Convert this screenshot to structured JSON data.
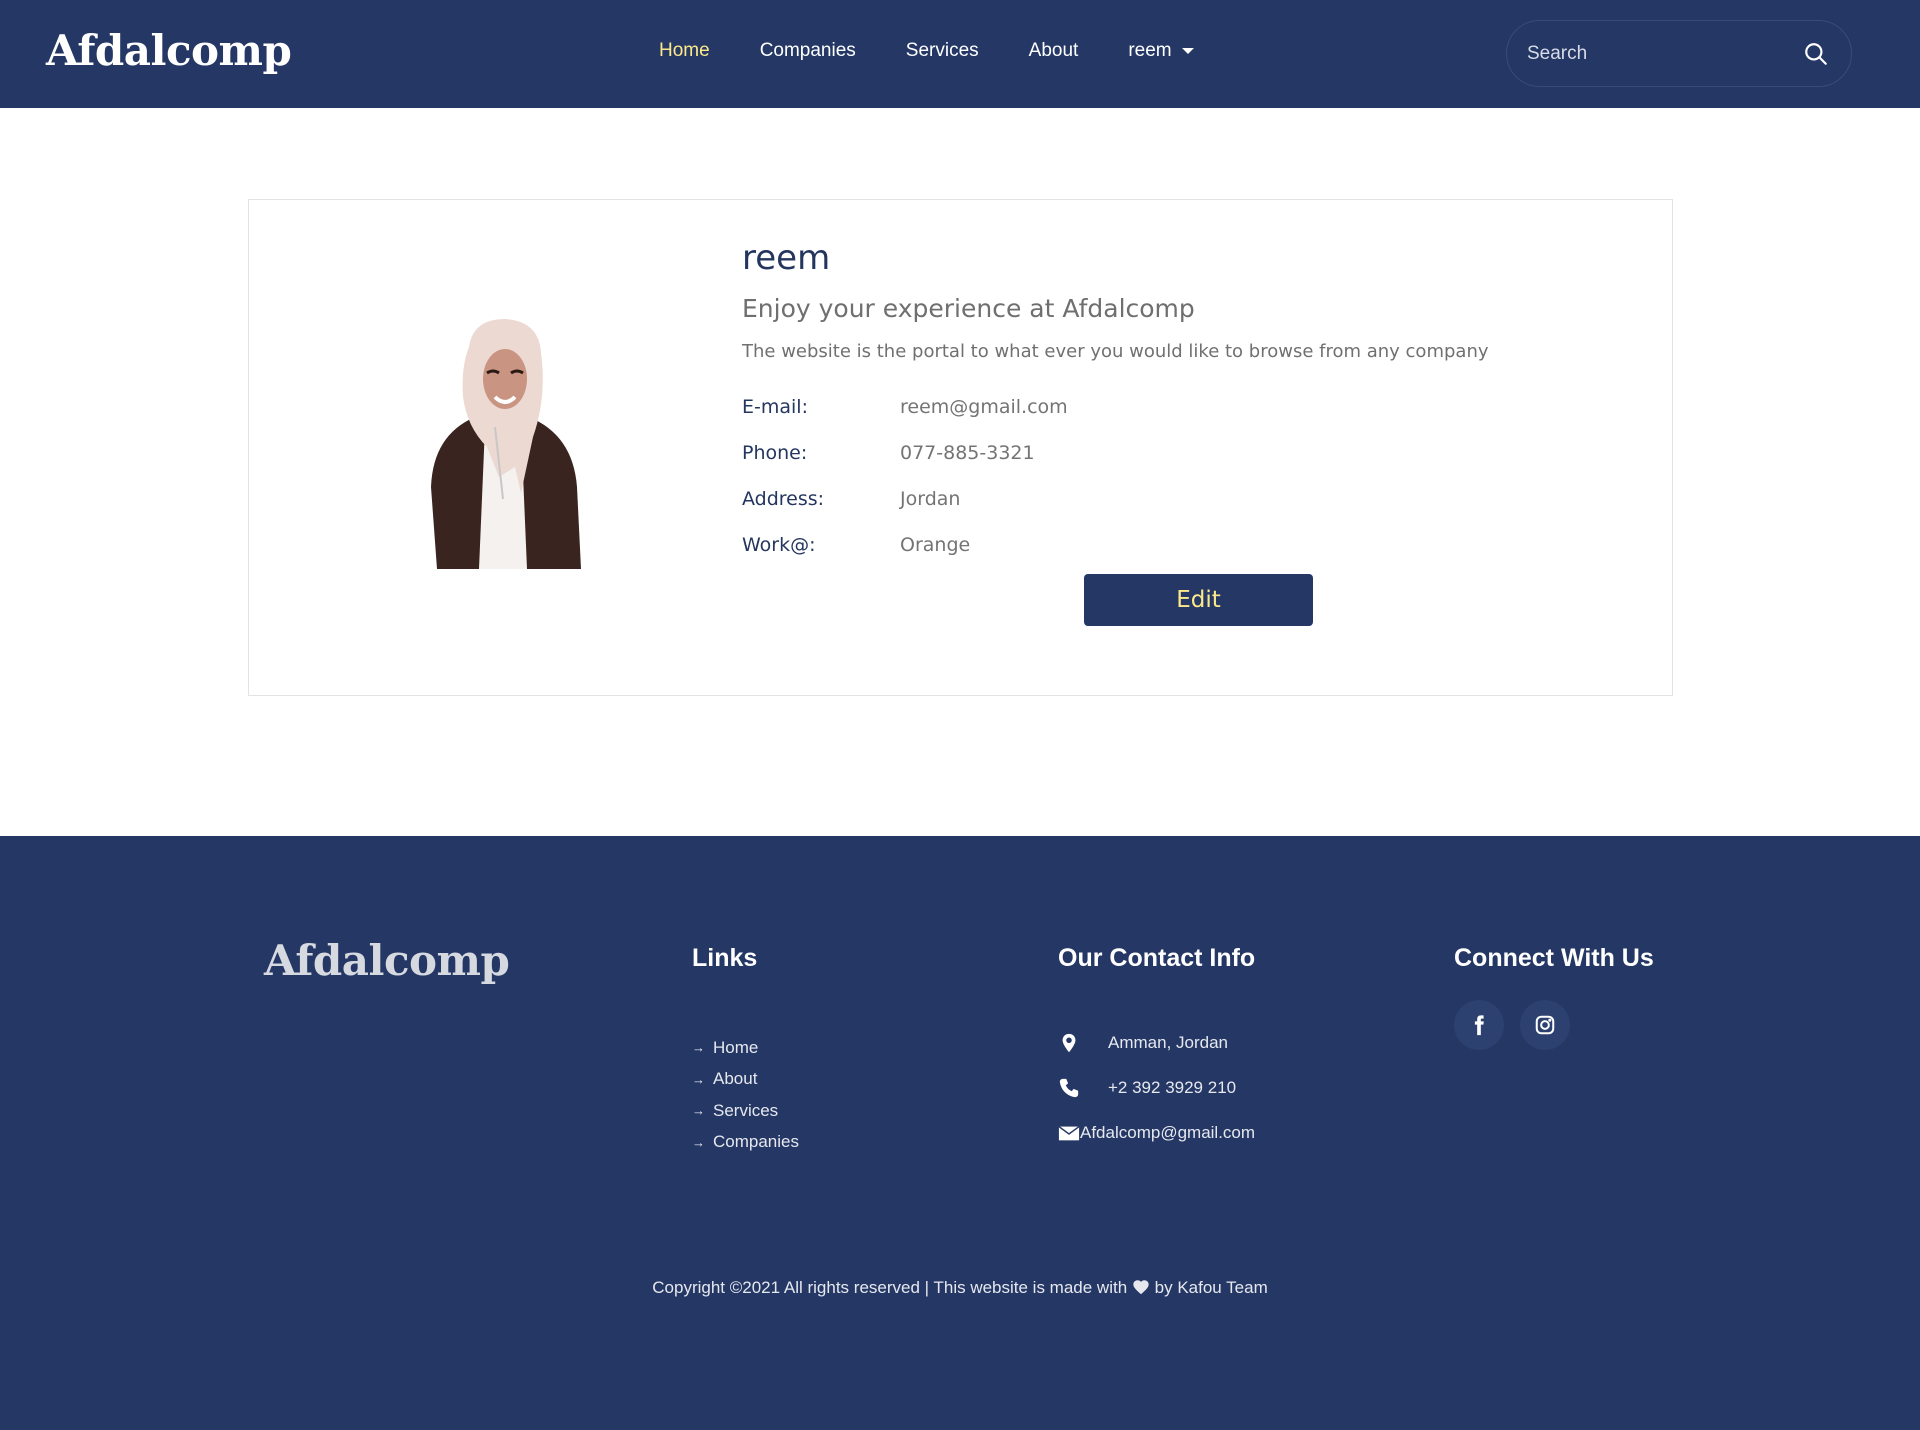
{
  "brand": {
    "name": "Afdalcomp"
  },
  "nav": {
    "items": [
      {
        "label": "Home",
        "active": true
      },
      {
        "label": "Companies"
      },
      {
        "label": "Services"
      },
      {
        "label": "About"
      }
    ],
    "user_menu_label": "reem"
  },
  "search": {
    "placeholder": "Search",
    "icon": "search-icon"
  },
  "profile": {
    "name": "reem",
    "tagline": "Enjoy your experience at Afdalcomp",
    "description": "The website is the portal to what ever you would like to browse from any company",
    "fields": [
      {
        "label": "E-mail:",
        "value": "reem@gmail.com"
      },
      {
        "label": "Phone:",
        "value": "077-885-3321"
      },
      {
        "label": "Address:",
        "value": "Jordan"
      },
      {
        "label": "Work@:",
        "value": "Orange"
      }
    ],
    "edit_label": "Edit"
  },
  "footer": {
    "brand": "Afdalcomp",
    "links_heading": "Links",
    "links": [
      "Home",
      "About",
      "Services",
      "Companies"
    ],
    "contact_heading": "Our Contact Info",
    "contact": {
      "address": "Amman, Jordan",
      "phone": "+2 392 3929 210",
      "email": "Afdalcomp@gmail.com"
    },
    "connect_heading": "Connect With Us",
    "social": [
      "facebook-icon",
      "instagram-icon"
    ],
    "copyright_before": "Copyright ©2021 All rights reserved | This website is made with",
    "copyright_after": "by Kafou Team"
  },
  "colors": {
    "navy": "#243765",
    "accent_yellow": "#fde98a",
    "muted_text": "#707070"
  }
}
